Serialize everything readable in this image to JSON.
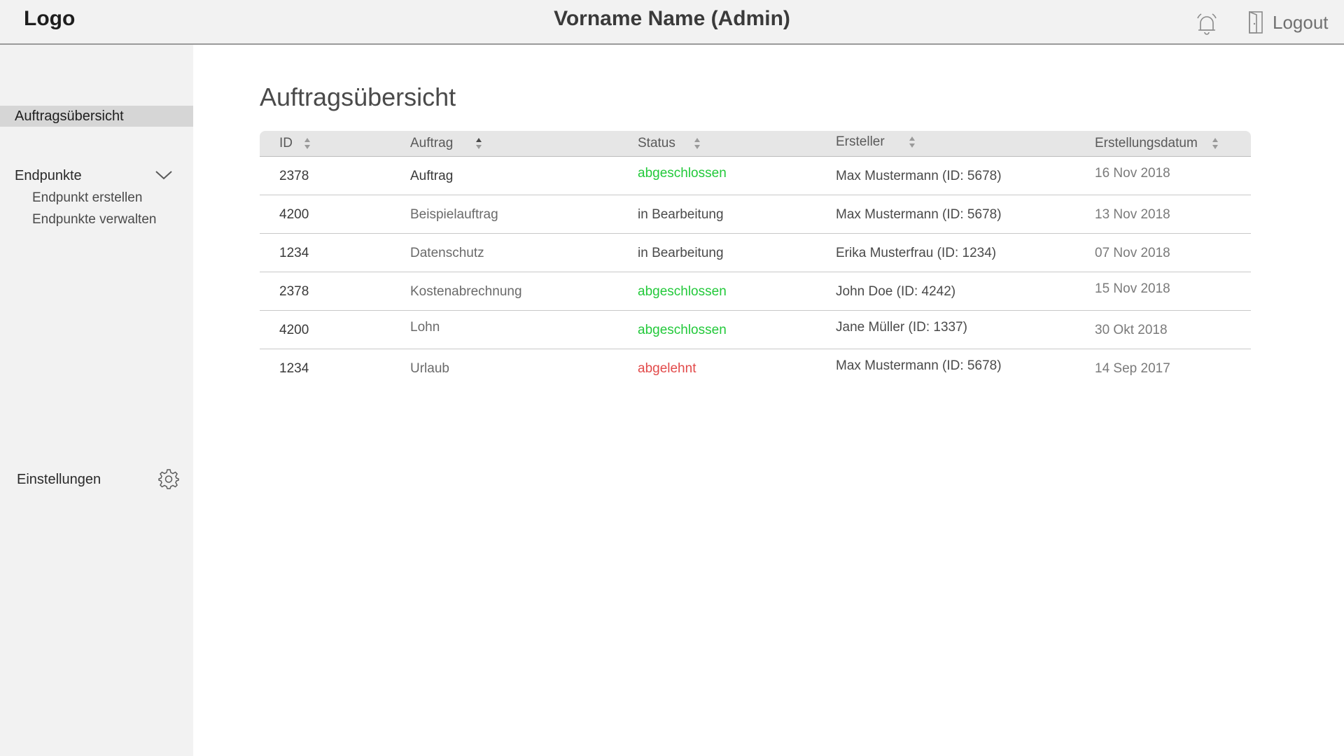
{
  "header": {
    "logo": "Logo",
    "user_title": "Vorname Name (Admin)",
    "bell_icon": "alarm-bell-icon",
    "logout_label": "Logout",
    "logout_icon": "door-exit-icon"
  },
  "sidebar": {
    "active_item": "Auftragsübersicht",
    "group_label": "Endpunkte",
    "group_icon": "chevron-down-icon",
    "sub_items": [
      "Endpunkt erstellen",
      "Endpunkte verwalten"
    ],
    "settings_label": "Einstellungen",
    "settings_icon": "gear-icon"
  },
  "main": {
    "title": "Auftragsübersicht",
    "columns": [
      "ID",
      "Auftrag",
      "Status",
      "Ersteller",
      "Erstellungsdatum"
    ],
    "rows": [
      {
        "id": "2378",
        "auftrag": "Auftrag",
        "status": "abgeschlossen",
        "ersteller": "Max Mustermann (ID: 5678)",
        "datum": "16 Nov 2018"
      },
      {
        "id": "4200",
        "auftrag": "Beispielauftrag",
        "status": "in Bearbeitung",
        "ersteller": "Max Mustermann (ID: 5678)",
        "datum": "13 Nov 2018"
      },
      {
        "id": "1234",
        "auftrag": "Datenschutz",
        "status": "in Bearbeitung",
        "ersteller": "Erika Musterfrau (ID: 1234)",
        "datum": "07 Nov 2018"
      },
      {
        "id": "2378",
        "auftrag": "Kostenabrechnung",
        "status": "abgeschlossen",
        "ersteller": "John Doe (ID: 4242)",
        "datum": "15 Nov 2018"
      },
      {
        "id": "4200",
        "auftrag": "Lohn",
        "status": "abgeschlossen",
        "ersteller": "Jane Müller (ID: 1337)",
        "datum": "30 Okt 2018"
      },
      {
        "id": "1234",
        "auftrag": "Urlaub",
        "status": "abgelehnt",
        "ersteller": "Max Mustermann (ID: 5678)",
        "datum": "14 Sep 2017"
      }
    ]
  },
  "colors": {
    "status_done": "#22c93a",
    "status_rejected": "#e24a4a",
    "status_in_progress": "#4a4a4a",
    "sidebar_bg": "#f2f2f2",
    "active_bg": "#d6d6d6"
  }
}
